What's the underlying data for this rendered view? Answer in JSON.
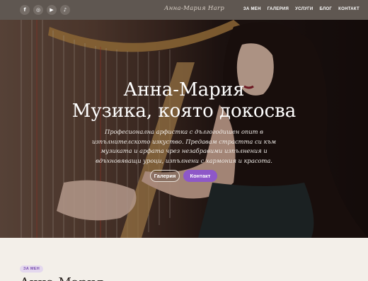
{
  "header": {
    "logo": "Анна-Мария Harp",
    "socials": [
      {
        "icon": "facebook-icon",
        "glyph": "f"
      },
      {
        "icon": "instagram-icon",
        "glyph": "◎"
      },
      {
        "icon": "youtube-icon",
        "glyph": "▶"
      },
      {
        "icon": "tiktok-icon",
        "glyph": "♪"
      }
    ],
    "nav": [
      "ЗА МЕН",
      "ГАЛЕРИЯ",
      "УСЛУГИ",
      "БЛОГ",
      "КОНТАКТ"
    ]
  },
  "hero": {
    "title_line1": "Анна-Мария",
    "title_line2": "Музика, която докосва",
    "description": "Професионална арфистка с дългогодишен опит в изпълнителското изкуство. Предавам страстта си към музиката и арфата чрез незабравими изпълнения и вдъхновяващи уроци, изпълнени с хармония и красота.",
    "btn_gallery": "Галерия",
    "btn_contact": "Контакт"
  },
  "about": {
    "badge": "ЗА МЕН",
    "heading": "Анна-Мария"
  },
  "colors": {
    "topbar": "#5f5751",
    "accent": "#8e58c8",
    "page_bg": "#f3efe9"
  }
}
